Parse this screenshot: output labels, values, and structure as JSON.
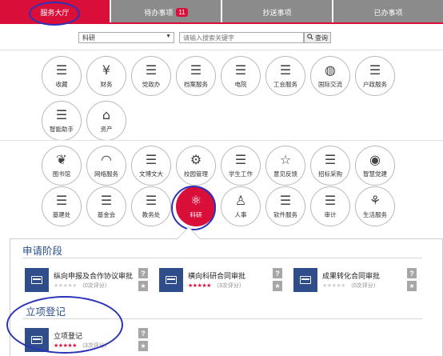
{
  "tabs": [
    {
      "label": "服务大厅",
      "active": true
    },
    {
      "label": "待办事项",
      "badge": "11",
      "active": false
    },
    {
      "label": "抄送事项",
      "active": false
    },
    {
      "label": "已办事项",
      "active": false
    }
  ],
  "search": {
    "category_value": "科研",
    "placeholder": "请输入搜索关键字",
    "button_label": "查询",
    "search_icon": "search-icon"
  },
  "grid": {
    "row1": [
      {
        "label": "收藏",
        "icon": "list-icon"
      },
      {
        "label": "财务",
        "icon": "money-bag-icon"
      },
      {
        "label": "党政办",
        "icon": "list-icon"
      },
      {
        "label": "档案服务",
        "icon": "list-icon"
      },
      {
        "label": "电院",
        "icon": "list-icon"
      },
      {
        "label": "工会服务",
        "icon": "list-icon"
      },
      {
        "label": "国际交流",
        "icon": "globe-icon"
      },
      {
        "label": "户政服务",
        "icon": "list-icon"
      }
    ],
    "row2": [
      {
        "label": "智能助手",
        "icon": "list-icon"
      },
      {
        "label": "资产",
        "icon": "home-icon"
      }
    ],
    "row3": [
      {
        "label": "图书馆",
        "icon": "book-icon"
      },
      {
        "label": "网络服务",
        "icon": "wifi-icon"
      },
      {
        "label": "文博文大",
        "icon": "list-icon"
      },
      {
        "label": "校园管理",
        "icon": "gear-icon"
      },
      {
        "label": "学生工作",
        "icon": "list-icon"
      },
      {
        "label": "意见反馈",
        "icon": "star-icon"
      },
      {
        "label": "招标采购",
        "icon": "list-icon"
      },
      {
        "label": "智慧党建",
        "icon": "party-emblem-icon"
      }
    ],
    "row4": [
      {
        "label": "基建处",
        "icon": "list-icon"
      },
      {
        "label": "基金会",
        "icon": "list-icon"
      },
      {
        "label": "教务处",
        "icon": "list-icon"
      },
      {
        "label": "科研",
        "icon": "atom-icon",
        "selected": true
      },
      {
        "label": "人事",
        "icon": "person-icon"
      },
      {
        "label": "软件服务",
        "icon": "list-icon"
      },
      {
        "label": "审计",
        "icon": "list-icon"
      },
      {
        "label": "生活服务",
        "icon": "plant-icon"
      }
    ]
  },
  "sections": {
    "apply": {
      "title": "申请阶段",
      "items": [
        {
          "name": "纵向申报及合作协议审批",
          "rating": 0,
          "count": "（0次评分）"
        },
        {
          "name": "横向科研合同审批",
          "rating": 5,
          "count": "（3次评分）"
        },
        {
          "name": "成果转化合同审批",
          "rating": 0,
          "count": "（0次评分）"
        }
      ]
    },
    "register": {
      "title": "立项登记",
      "items": [
        {
          "name": "立项登记",
          "rating": 5,
          "count": "（3次评分）"
        }
      ]
    }
  },
  "card_help_glyph": "?",
  "card_fav_glyph": "★",
  "colors": {
    "accent": "#d90f3a",
    "tab_inactive": "#8b8b8b",
    "card_icon": "#2f4d8a",
    "section_title": "#2a4f8f",
    "annotation_circle": "#2a33b8"
  }
}
